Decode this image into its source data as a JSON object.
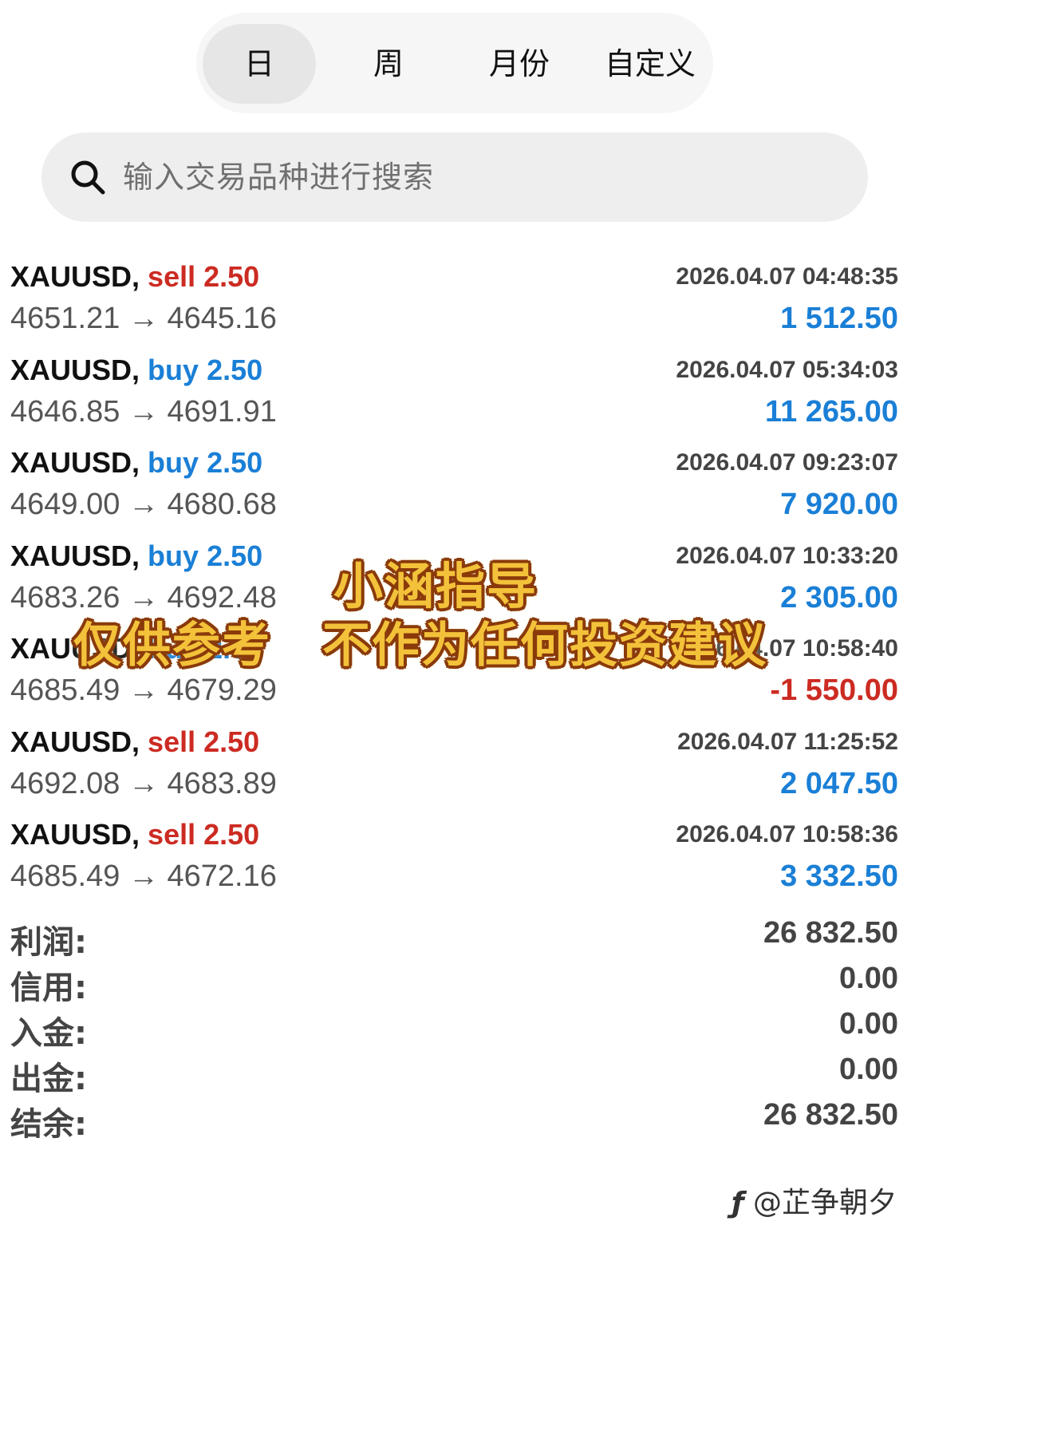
{
  "tabs": [
    {
      "label": "日",
      "active": true
    },
    {
      "label": "周",
      "active": false
    },
    {
      "label": "月份",
      "active": false
    },
    {
      "label": "自定义",
      "active": false
    }
  ],
  "search": {
    "placeholder": "输入交易品种进行搜索",
    "icon": "search-icon"
  },
  "trades": [
    {
      "symbol": "XAUUSD,",
      "side": "sell",
      "volume": "2.50",
      "open": "4651.21",
      "close": "4645.16",
      "time": "2026.04.07 04:48:35",
      "profit": "1 512.50"
    },
    {
      "symbol": "XAUUSD,",
      "side": "buy",
      "volume": "2.50",
      "open": "4646.85",
      "close": "4691.91",
      "time": "2026.04.07 05:34:03",
      "profit": "11 265.00"
    },
    {
      "symbol": "XAUUSD,",
      "side": "buy",
      "volume": "2.50",
      "open": "4649.00",
      "close": "4680.68",
      "time": "2026.04.07 09:23:07",
      "profit": "7 920.00"
    },
    {
      "symbol": "XAUUSD,",
      "side": "buy",
      "volume": "2.50",
      "open": "4683.26",
      "close": "4692.48",
      "time": "2026.04.07 10:33:20",
      "profit": "2 305.00"
    },
    {
      "symbol": "XAUUSD,",
      "side": "buy",
      "volume": "2.50",
      "open": "4685.49",
      "close": "4679.29",
      "time": "2026.04.07 10:58:40",
      "profit": "-1 550.00"
    },
    {
      "symbol": "XAUUSD,",
      "side": "sell",
      "volume": "2.50",
      "open": "4692.08",
      "close": "4683.89",
      "time": "2026.04.07 11:25:52",
      "profit": "2 047.50"
    },
    {
      "symbol": "XAUUSD,",
      "side": "sell",
      "volume": "2.50",
      "open": "4685.49",
      "close": "4672.16",
      "time": "2026.04.07 10:58:36",
      "profit": "3 332.50"
    }
  ],
  "arrow": "→",
  "summary": [
    {
      "label": "利润:",
      "value": "26 832.50"
    },
    {
      "label": "信用:",
      "value": "0.00"
    },
    {
      "label": "入金:",
      "value": "0.00"
    },
    {
      "label": "出金:",
      "value": "0.00"
    },
    {
      "label": "结余:",
      "value": "26 832.50"
    }
  ],
  "watermark": {
    "title": "小涵指导",
    "disclaimer_left": "仅供参考",
    "disclaimer_right": "不作为任何投资建议"
  },
  "credit": "@芷争朝夕",
  "colors": {
    "buy": "#1a7fd6",
    "sell": "#cc2b22",
    "watermark_fill": "#f3c23a",
    "watermark_outline": "#8a3a0a"
  }
}
